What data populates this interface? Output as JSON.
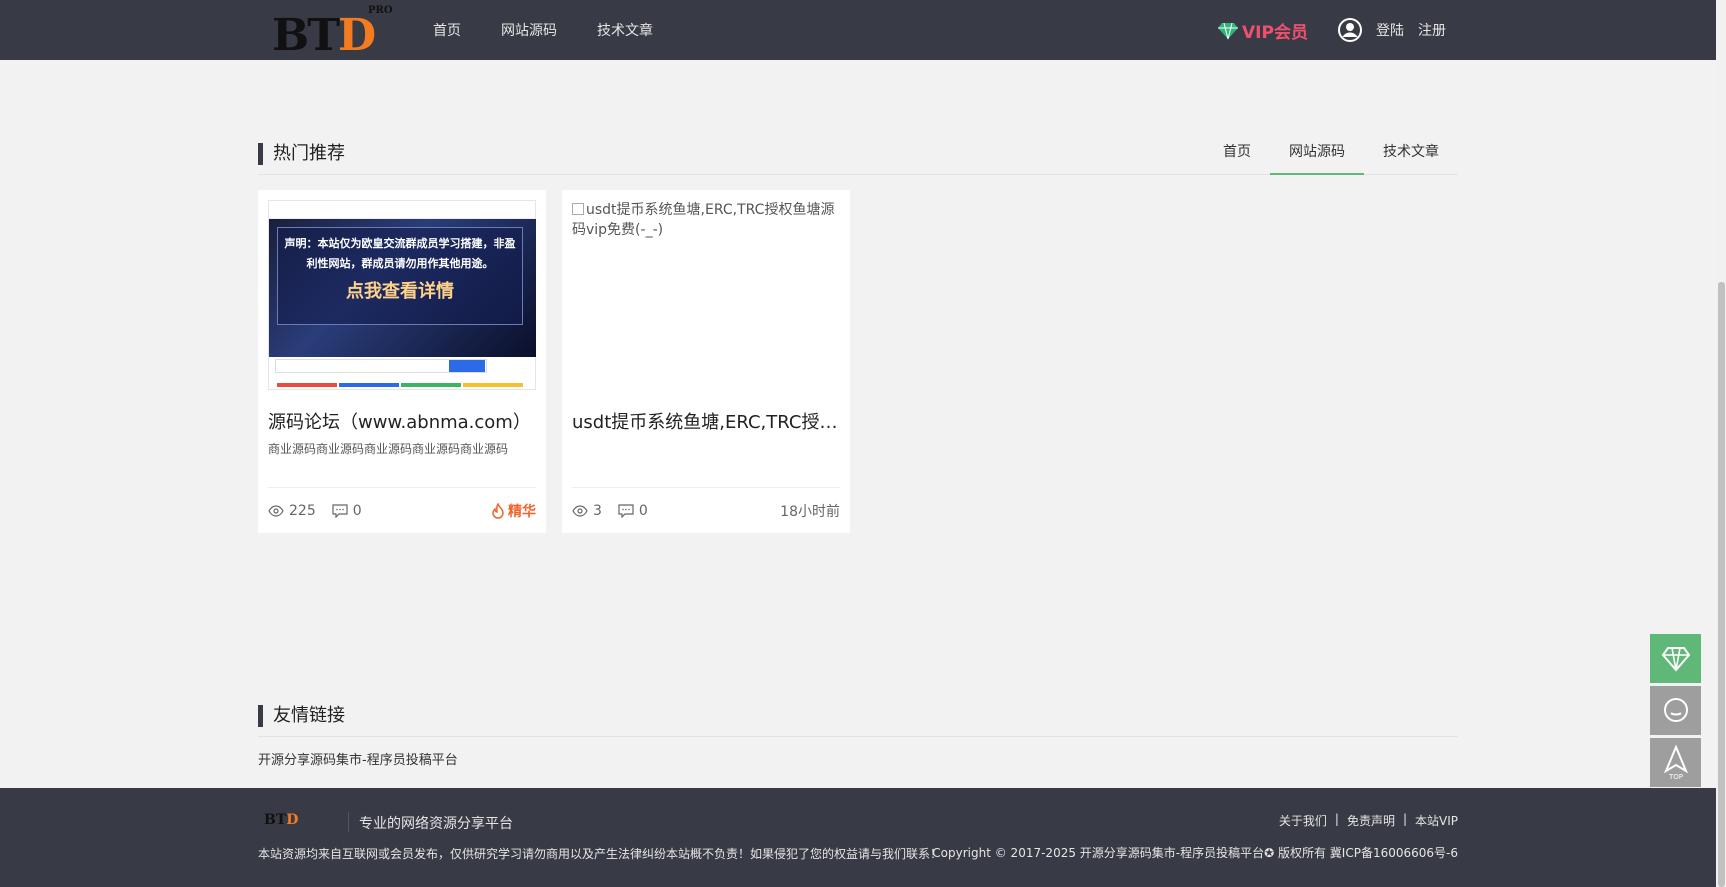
{
  "header": {
    "logo_text_main": "BT",
    "logo_text_accent": "D",
    "logo_super": "PRO",
    "nav": [
      "首页",
      "网站源码",
      "技术文章"
    ],
    "vip_label": "VIP会员",
    "login": "登陆",
    "register": "注册"
  },
  "hot": {
    "title": "热门推荐",
    "tabs": [
      {
        "label": "首页",
        "active": false
      },
      {
        "label": "网站源码",
        "active": true
      },
      {
        "label": "技术文章",
        "active": false
      }
    ]
  },
  "cards": [
    {
      "title": "源码论坛（www.abnma.com）",
      "desc": "商业源码商业源码商业源码商业源码商业源码",
      "views": "225",
      "comments": "0",
      "badge": "精华",
      "thumb_notice_line1": "声明：本站仅为欧皇交流群成员学习搭建，非盈",
      "thumb_notice_line2": "利性网站，群成员请勿用作其他用途。",
      "thumb_button": "点我查看详情"
    },
    {
      "title": "usdt提币系统鱼塘,ERC,TRC授权鱼塘源码vip免费(-_-)",
      "img_alt": "usdt提币系统鱼塘,ERC,TRC授权鱼塘源码vip免费(-_-)",
      "views": "3",
      "comments": "0",
      "time": "18小时前"
    }
  ],
  "friend_links": {
    "title": "友情链接",
    "items": [
      "开源分享源码集市-程序员投稿平台"
    ]
  },
  "footer": {
    "slogan": "专业的网络资源分享平台",
    "links": [
      "关于我们",
      "免责声明",
      "本站VIP"
    ],
    "disclaimer": "本站资源均来自互联网或会员发布，仅供研究学习请勿商用以及产生法律纠纷本站概不负责！如果侵犯了您的权益请与我们联系！",
    "copyright": "Copyright © 2017-2025 开源分享源码集市-程序员投稿平台✪ 版权所有 冀ICP备16006606号-6"
  },
  "colors": {
    "header_bg": "#383b45",
    "accent_green": "#5fb878",
    "vip_pink": "#f0506e",
    "hot_orange": "#f0642d",
    "logo_orange": "#f47b20"
  }
}
